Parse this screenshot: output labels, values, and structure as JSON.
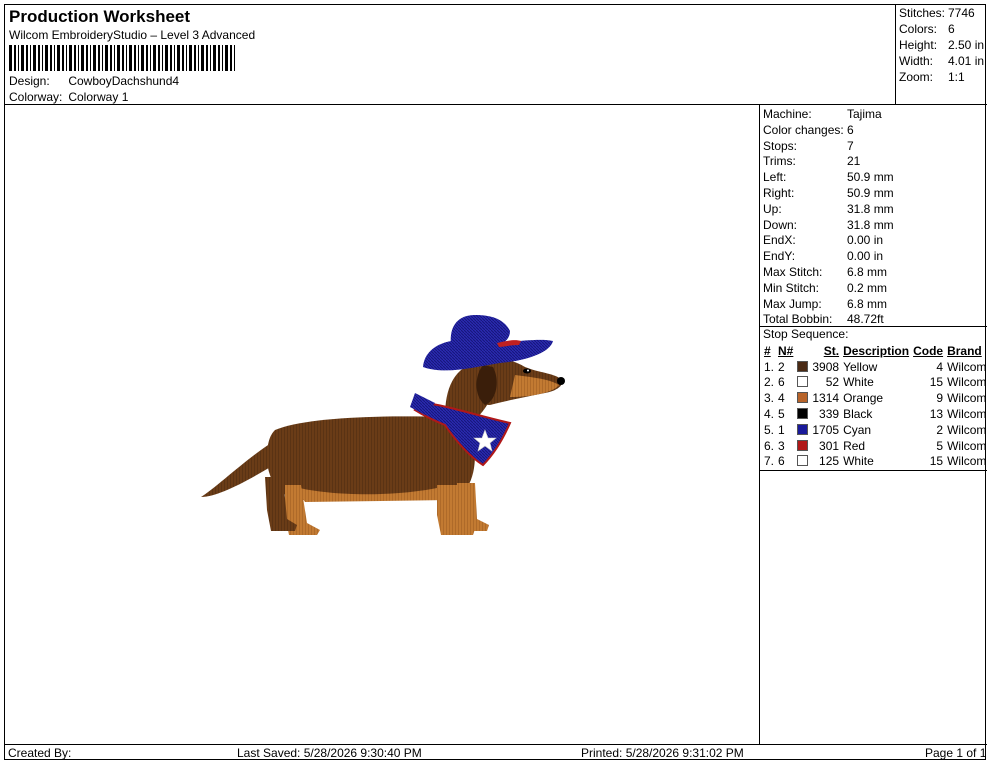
{
  "header": {
    "title": "Production Worksheet",
    "subtitle": "Wilcom EmbroideryStudio – Level 3 Advanced",
    "design_label": "Design:",
    "design_value": "CowboyDachshund4",
    "colorway_label": "Colorway:",
    "colorway_value": "Colorway 1"
  },
  "summary": [
    {
      "label": "Stitches:",
      "value": "7746"
    },
    {
      "label": "Colors:",
      "value": "6"
    },
    {
      "label": "Height:",
      "value": "2.50 in"
    },
    {
      "label": "Width:",
      "value": "4.01 in"
    },
    {
      "label": "Zoom:",
      "value": "1:1"
    }
  ],
  "machine": [
    {
      "label": "Machine:",
      "value": "Tajima"
    },
    {
      "label": "Color changes:",
      "value": "6"
    },
    {
      "label": "Stops:",
      "value": "7"
    },
    {
      "label": "Trims:",
      "value": "21"
    },
    {
      "label": "Left:",
      "value": "50.9 mm"
    },
    {
      "label": "Right:",
      "value": "50.9 mm"
    },
    {
      "label": "Up:",
      "value": "31.8 mm"
    },
    {
      "label": "Down:",
      "value": "31.8 mm"
    },
    {
      "label": "EndX:",
      "value": "0.00 in"
    },
    {
      "label": "EndY:",
      "value": "0.00 in"
    },
    {
      "label": "Max Stitch:",
      "value": "6.8 mm"
    },
    {
      "label": "Min Stitch:",
      "value": "0.2 mm"
    },
    {
      "label": "Max Jump:",
      "value": "6.8 mm"
    },
    {
      "label": "Total Bobbin:",
      "value": "48.72ft"
    }
  ],
  "stop_sequence": {
    "title": "Stop Sequence:",
    "headers": {
      "num": "#",
      "n": "N#",
      "st": "St.",
      "desc": "Description",
      "code": "Code",
      "brand": "Brand"
    },
    "rows": [
      {
        "num": "1.",
        "n": "2",
        "color": "#4a2a14",
        "st": "3908",
        "desc": "Yellow",
        "code": "4",
        "brand": "Wilcom"
      },
      {
        "num": "2.",
        "n": "6",
        "color": "#ffffff",
        "st": "52",
        "desc": "White",
        "code": "15",
        "brand": "Wilcom"
      },
      {
        "num": "3.",
        "n": "4",
        "color": "#b8642a",
        "st": "1314",
        "desc": "Orange",
        "code": "9",
        "brand": "Wilcom"
      },
      {
        "num": "4.",
        "n": "5",
        "color": "#000000",
        "st": "339",
        "desc": "Black",
        "code": "13",
        "brand": "Wilcom"
      },
      {
        "num": "5.",
        "n": "1",
        "color": "#1a1a9a",
        "st": "1705",
        "desc": "Cyan",
        "code": "2",
        "brand": "Wilcom"
      },
      {
        "num": "6.",
        "n": "3",
        "color": "#b01818",
        "st": "301",
        "desc": "Red",
        "code": "5",
        "brand": "Wilcom"
      },
      {
        "num": "7.",
        "n": "6",
        "color": "#ffffff",
        "st": "125",
        "desc": "White",
        "code": "15",
        "brand": "Wilcom"
      }
    ]
  },
  "footer": {
    "created_by": "Created By:",
    "last_saved": "Last Saved: 5/28/2026 9:30:40 PM",
    "printed": "Printed: 5/28/2026 9:31:02 PM",
    "page": "Page 1 of 1"
  }
}
